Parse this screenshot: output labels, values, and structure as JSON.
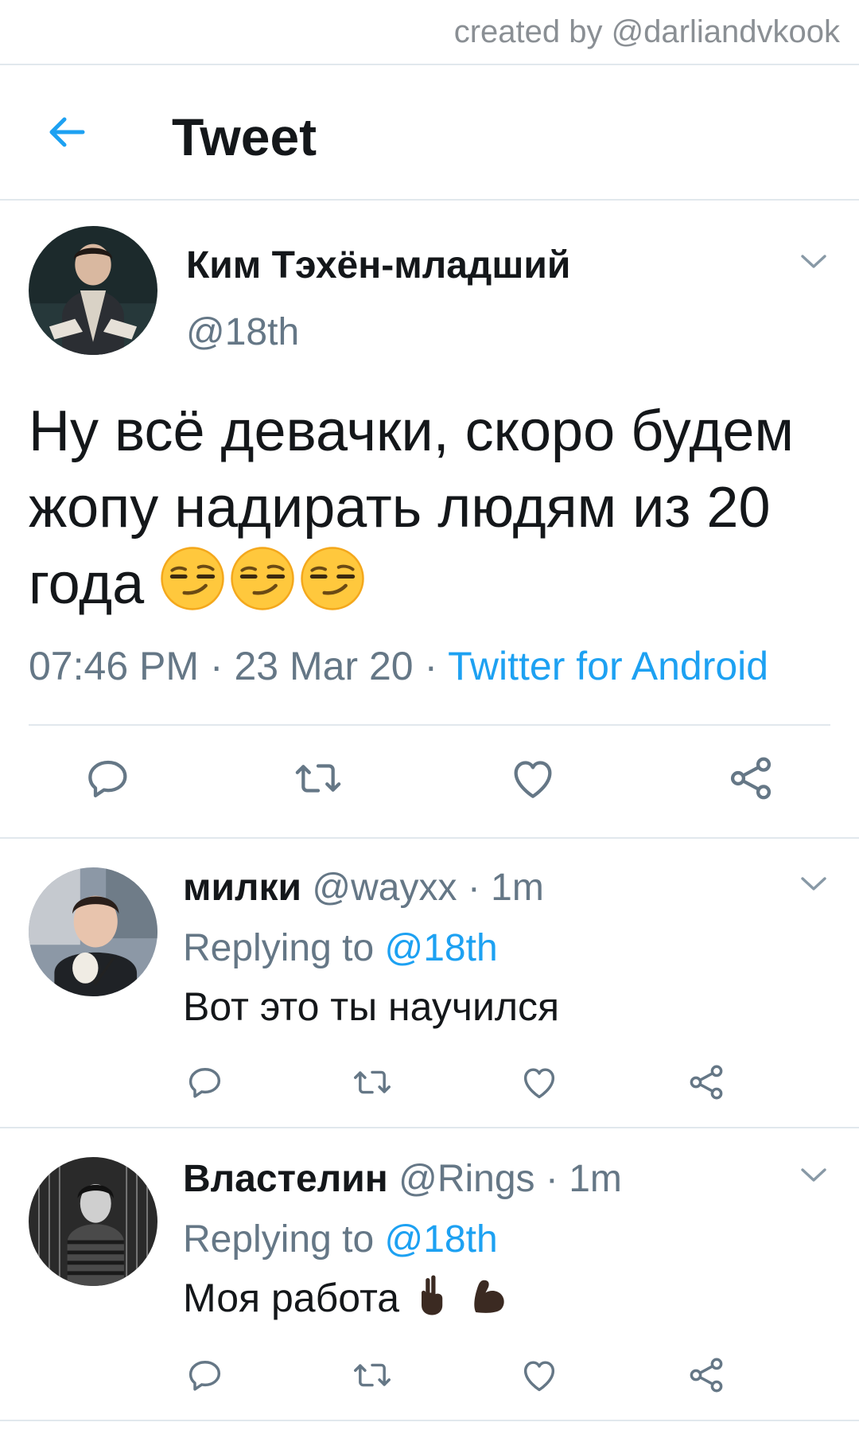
{
  "credit": "created by @darliandvkook",
  "header": {
    "title": "Tweet"
  },
  "tweet": {
    "name": "Ким Тэхён-младший",
    "handle": "@18th",
    "text": "Ну всё девачки, скоро будем жопу надирать людям из 20 года",
    "emoji": [
      "smirking-face",
      "smirking-face",
      "smirking-face"
    ],
    "time": "07:46 PM",
    "date": "23 Mar 20",
    "source": "Twitter for Android",
    "separator": " · "
  },
  "replies": [
    {
      "name": "милки",
      "handle": "@wayxx",
      "time": "1m",
      "replying_label": "Replying to",
      "replying_to": "@18th",
      "text": "Вот это ты научился"
    },
    {
      "name": "Властелин",
      "handle": "@Rings",
      "time": "1m",
      "replying_label": "Replying to",
      "replying_to": "@18th",
      "text": "Моя работа",
      "emoji": [
        "victory-hand-dark",
        "flexed-biceps-dark"
      ]
    }
  ],
  "actions": [
    "reply-icon",
    "retweet-icon",
    "like-icon",
    "share-icon"
  ],
  "colors": {
    "accent": "#1da1f2",
    "secondary_text": "#657786",
    "divider": "#e1e8ed"
  }
}
